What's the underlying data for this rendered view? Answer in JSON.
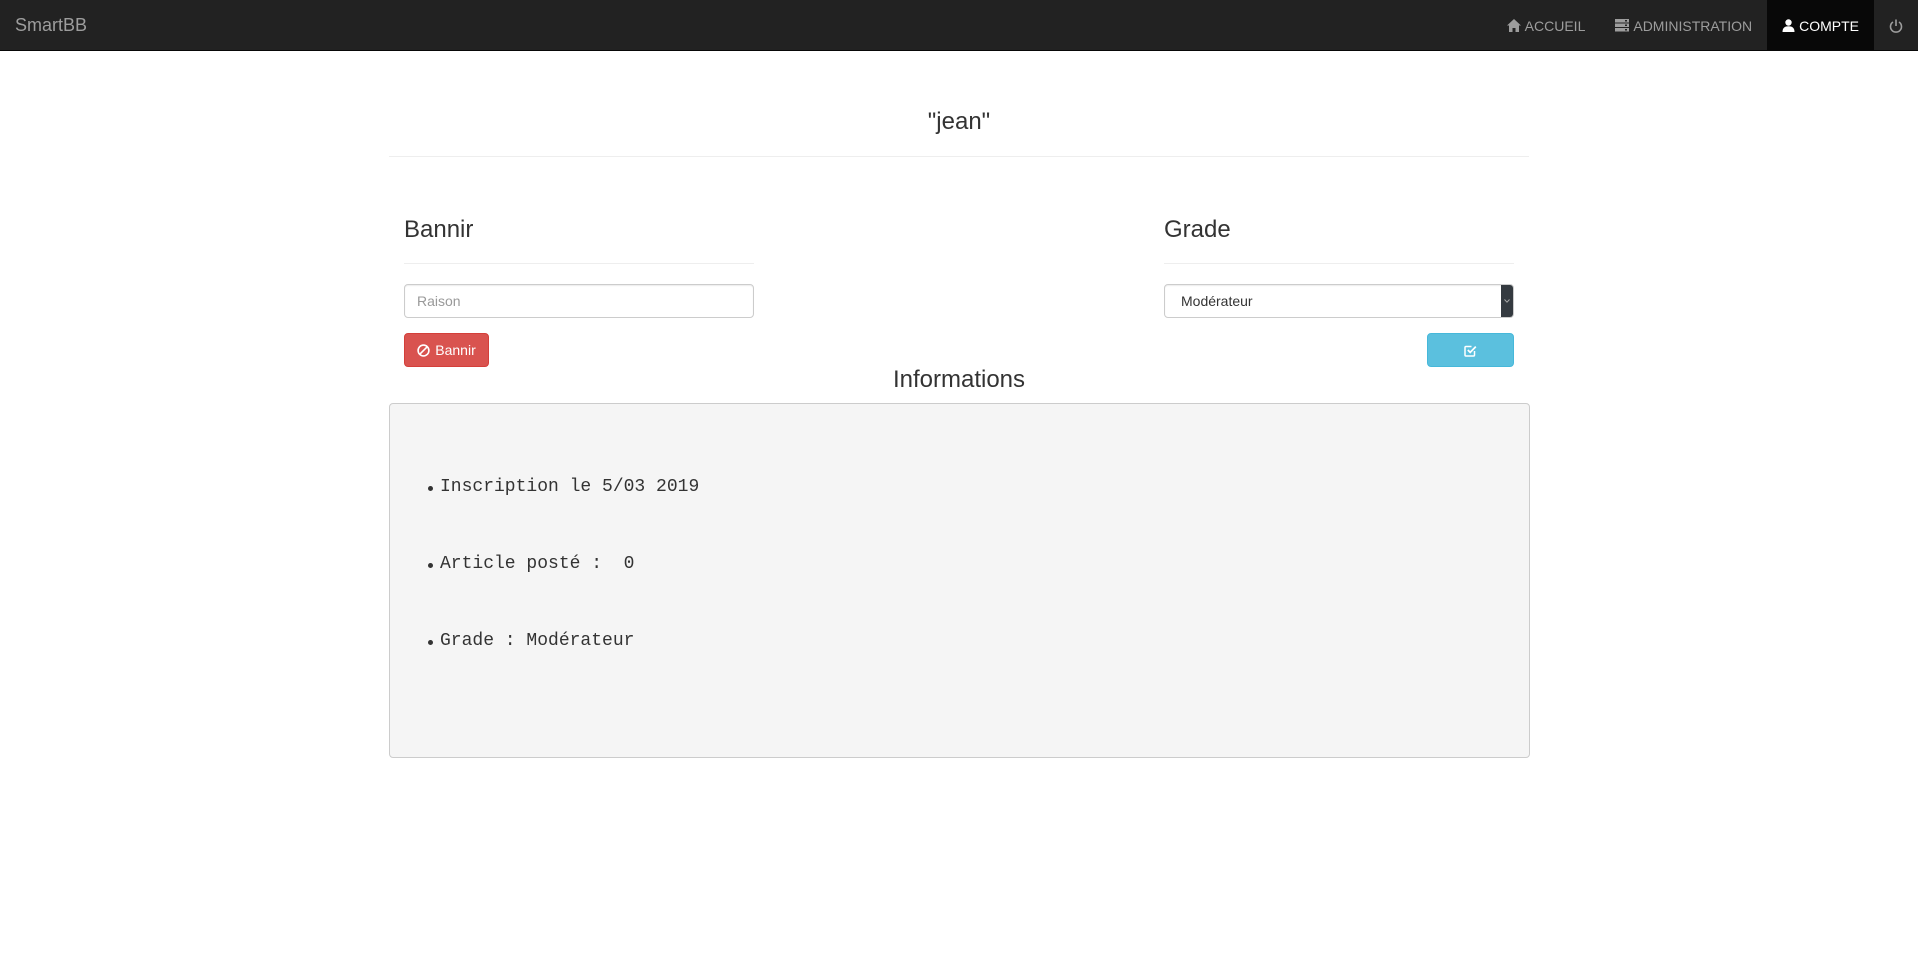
{
  "navbar": {
    "brand": "SmartBB",
    "items": [
      {
        "label": "ACCUEIL",
        "icon": "home-icon",
        "active": false
      },
      {
        "label": "ADMINISTRATION",
        "icon": "server-icon",
        "active": false
      },
      {
        "label": "COMPTE",
        "icon": "user-icon",
        "active": true
      }
    ],
    "logout_icon": "power-icon"
  },
  "profile": {
    "title": "\"jean\""
  },
  "ban": {
    "title": "Bannir",
    "reason_placeholder": "Raison",
    "reason_value": "",
    "button_label": "Bannir",
    "button_icon": "ban-icon",
    "button_color": "#d9534f"
  },
  "grade": {
    "title": "Grade",
    "selected": "Modérateur",
    "submit_icon": "check-square-icon",
    "submit_color": "#5bc0de"
  },
  "informations": {
    "title": "Informations",
    "items": [
      "Inscription le 5/03 2019",
      "Article posté :  0",
      "Grade : Modérateur"
    ]
  }
}
